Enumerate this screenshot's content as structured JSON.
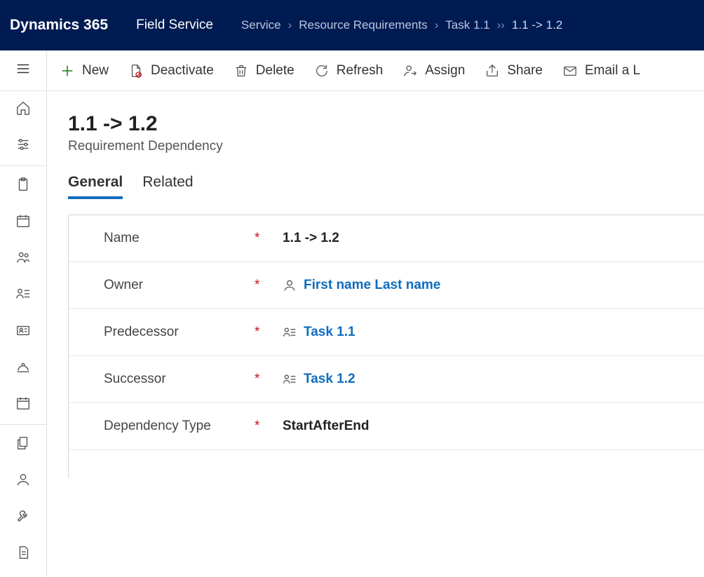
{
  "header": {
    "app_name": "Dynamics 365",
    "module": "Field Service",
    "breadcrumb": {
      "bc1": "Service",
      "bc2": "Resource Requirements",
      "bc3": "Task 1.1",
      "current": "1.1 -> 1.2"
    }
  },
  "commands": {
    "new": "New",
    "deactivate": "Deactivate",
    "delete": "Delete",
    "refresh": "Refresh",
    "assign": "Assign",
    "share": "Share",
    "email": "Email a L"
  },
  "record": {
    "title": "1.1 -> 1.2",
    "subtitle": "Requirement Dependency"
  },
  "tabs": {
    "general": "General",
    "related": "Related"
  },
  "form": {
    "name": {
      "label": "Name",
      "value": "1.1 -> 1.2"
    },
    "owner": {
      "label": "Owner",
      "value": "First name Last name"
    },
    "predecessor": {
      "label": "Predecessor",
      "value": "Task 1.1"
    },
    "successor": {
      "label": "Successor",
      "value": "Task 1.2"
    },
    "dependency_type": {
      "label": "Dependency Type",
      "value": "StartAfterEnd"
    }
  }
}
